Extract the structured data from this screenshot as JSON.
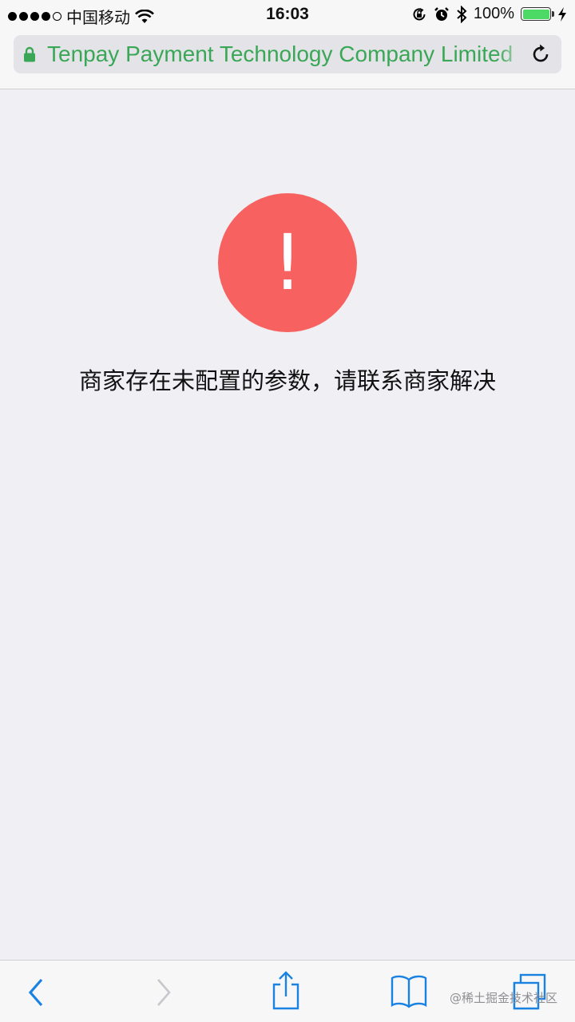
{
  "status_bar": {
    "carrier": "中国移动",
    "time": "16:03",
    "battery_percent": "100%",
    "signal_bars": 4,
    "icons": [
      "signal-dots-icon",
      "wifi-icon",
      "rotation-lock-icon",
      "alarm-icon",
      "bluetooth-icon",
      "battery-icon",
      "charging-icon"
    ]
  },
  "address_bar": {
    "site_name": "Tenpay Payment Technology Company Limited",
    "secure": true,
    "icons": [
      "lock-icon",
      "reload-icon"
    ]
  },
  "error": {
    "mark": "!",
    "message": "商家存在未配置的参数，请联系商家解决",
    "icon": "warning-icon"
  },
  "toolbar": {
    "buttons": [
      "back-button",
      "forward-button",
      "share-button",
      "bookmarks-button",
      "tabs-button"
    ],
    "watermark": "@稀土掘金技术社区"
  },
  "colors": {
    "accent": "#3aa757",
    "error": "#f76260",
    "toolbar_tint": "#1a82e2",
    "background": "#efeff4"
  }
}
